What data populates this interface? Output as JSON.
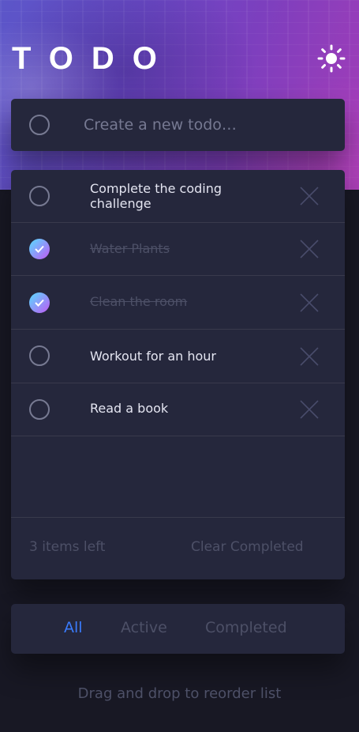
{
  "header": {
    "title": "TODO",
    "theme_toggle_icon": "sun-icon"
  },
  "new_todo": {
    "placeholder": "Create a new todo…",
    "value": ""
  },
  "todos": [
    {
      "text": "Complete the coding challenge",
      "completed": false
    },
    {
      "text": "Water Plants",
      "completed": true
    },
    {
      "text": "Clean the room",
      "completed": true
    },
    {
      "text": "Workout for an hour",
      "completed": false
    },
    {
      "text": "Read a book",
      "completed": false
    }
  ],
  "list_footer": {
    "items_left": "3 items left",
    "clear_completed": "Clear Completed"
  },
  "filters": {
    "all": "All",
    "active": "Active",
    "completed": "Completed",
    "selected": "All"
  },
  "hint": "Drag and drop to reorder list",
  "colors": {
    "accent": "#3a7bfd",
    "check_gradient_start": "#57ddff",
    "check_gradient_end": "#c058f3",
    "card_background": "#25273c",
    "page_background": "#181824"
  }
}
